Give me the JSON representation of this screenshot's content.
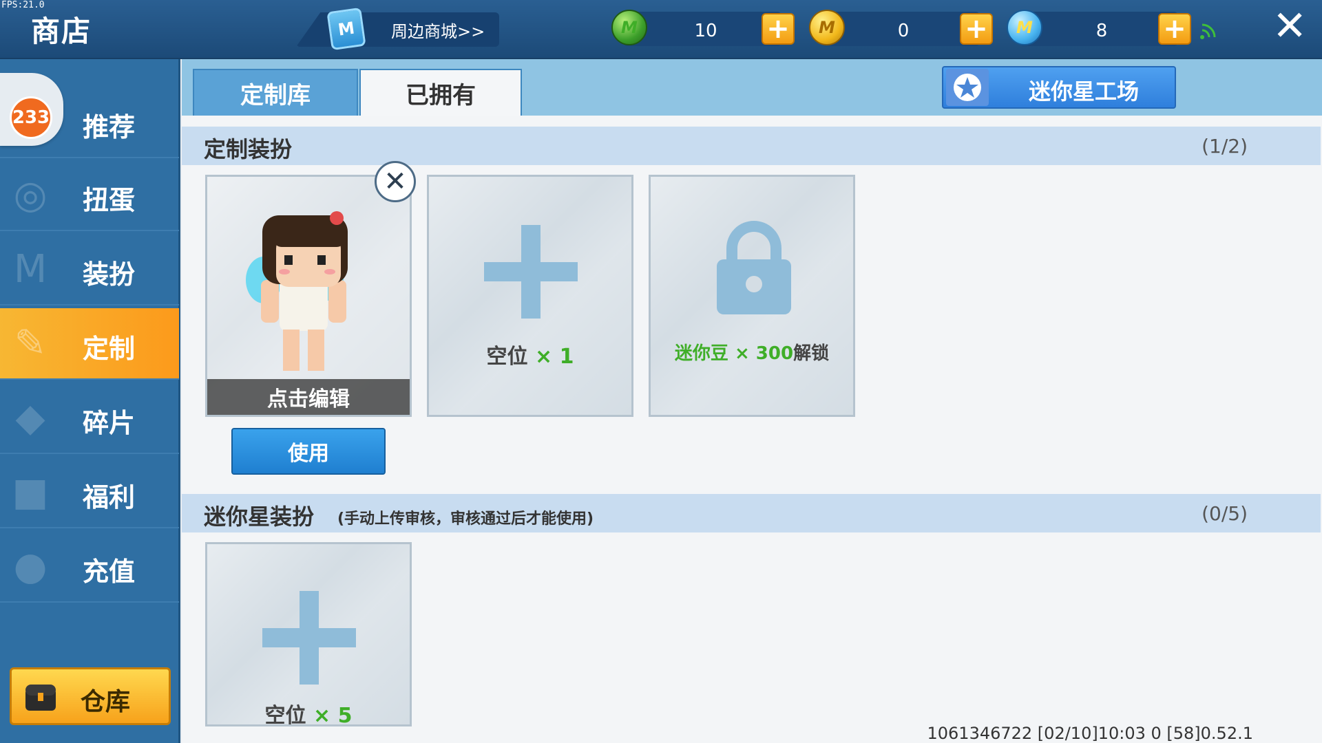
{
  "fps": "FPS:21.0",
  "header": {
    "title": "商店",
    "mall_link": "周边商城>>",
    "mall_icon_letter": "M",
    "currencies": [
      {
        "icon": "green-gem-icon",
        "value": "10"
      },
      {
        "icon": "gold-coin-icon",
        "value": "0"
      },
      {
        "icon": "mini-bean-icon",
        "value": "8"
      }
    ],
    "plus_symbol": "+",
    "close_symbol": "✕"
  },
  "sidebar": {
    "badge": "233",
    "items": [
      {
        "label": "推荐",
        "icon": "recommend-icon"
      },
      {
        "label": "扭蛋",
        "icon": "gacha-icon"
      },
      {
        "label": "装扮",
        "icon": "outfit-icon"
      },
      {
        "label": "定制",
        "icon": "customize-icon",
        "active": true
      },
      {
        "label": "碎片",
        "icon": "fragment-icon"
      },
      {
        "label": "福利",
        "icon": "gift-icon"
      },
      {
        "label": "充值",
        "icon": "coins-icon"
      }
    ],
    "warehouse": "仓库"
  },
  "tabs": {
    "items": [
      "定制库",
      "已拥有"
    ],
    "active_index": 1,
    "workshop": "迷你星工场"
  },
  "custom_section": {
    "title": "定制装扮",
    "count": "(1/2)",
    "edit_label": "点击编辑",
    "remove_symbol": "✕",
    "use_label": "使用",
    "empty_slot_text": "空位",
    "empty_slot_mult": "× 1",
    "locked_currency": "迷你豆 × 300",
    "locked_suffix": "解锁"
  },
  "mini_section": {
    "title": "迷你星装扮",
    "subtitle": "(手动上传审核，审核通过后才能使用)",
    "count": "(0/5)",
    "empty_slot_text": "空位",
    "empty_slot_mult": "× 5"
  },
  "footer": "1061346722   [02/10]10:03 0  [58]0.52.1",
  "colors": {
    "accent_orange": "#f7b733",
    "accent_blue": "#2f7fdc",
    "green_text": "#3fae28",
    "slot_plus": "#8fbcd9"
  }
}
